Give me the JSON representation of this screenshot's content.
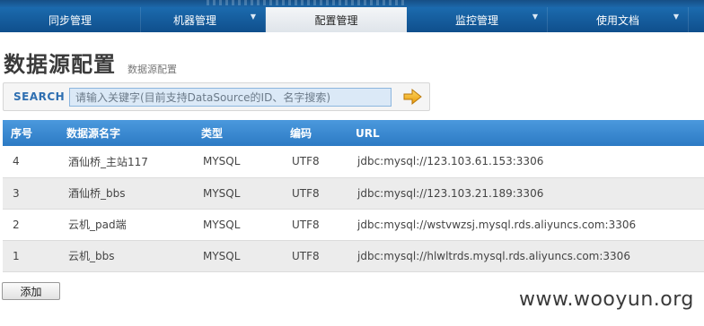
{
  "nav": {
    "tabs": [
      {
        "label": "同步管理",
        "has_dropdown": false,
        "active": false
      },
      {
        "label": "机器管理",
        "has_dropdown": true,
        "active": false
      },
      {
        "label": "配置管理",
        "has_dropdown": false,
        "active": true
      },
      {
        "label": "监控管理",
        "has_dropdown": true,
        "active": false
      },
      {
        "label": "使用文档",
        "has_dropdown": true,
        "active": false
      }
    ]
  },
  "page": {
    "title": "数据源配置",
    "subtitle": "数据源配置"
  },
  "search": {
    "label": "SEARCH",
    "placeholder": "请输入关键字(目前支持DataSource的ID、名字搜索)",
    "button_icon": "arrow-right-icon"
  },
  "table": {
    "headers": [
      "序号",
      "数据源名字",
      "类型",
      "编码",
      "URL"
    ],
    "rows": [
      {
        "id": "4",
        "name": "酒仙桥_主站117",
        "type": "MYSQL",
        "encoding": "UTF8",
        "url": "jdbc:mysql://123.103.61.153:3306"
      },
      {
        "id": "3",
        "name": "酒仙桥_bbs",
        "type": "MYSQL",
        "encoding": "UTF8",
        "url": "jdbc:mysql://123.103.21.189:3306"
      },
      {
        "id": "2",
        "name": "云机_pad端",
        "type": "MYSQL",
        "encoding": "UTF8",
        "url": "jdbc:mysql://wstvwzsj.mysql.rds.aliyuncs.com:3306"
      },
      {
        "id": "1",
        "name": "云机_bbs",
        "type": "MYSQL",
        "encoding": "UTF8",
        "url": "jdbc:mysql://hlwltrds.mysql.rds.aliyuncs.com:3306"
      }
    ]
  },
  "actions": {
    "add_label": "添加"
  },
  "watermark": "www.wooyun.org",
  "colors": {
    "nav_bg": "#1a5f9e",
    "header_bg": "#3a8ad2",
    "search_label": "#2f6fb1",
    "search_arrow": "#f2b21a"
  }
}
